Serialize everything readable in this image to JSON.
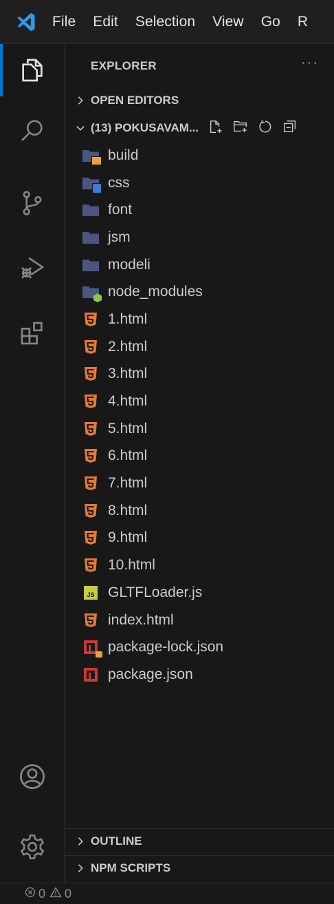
{
  "menubar": {
    "items": [
      "File",
      "Edit",
      "Selection",
      "View",
      "Go",
      "R"
    ]
  },
  "activity_bar": {
    "items": [
      "explorer-icon",
      "search-icon",
      "source-control-icon",
      "run-debug-icon",
      "extensions-icon"
    ],
    "bottom": [
      "accounts-icon",
      "manage-gear-icon"
    ],
    "accent_color": "#0078d4"
  },
  "explorer": {
    "title": "EXPLORER",
    "more": "···",
    "open_editors": "OPEN EDITORS",
    "folder": "(13) POKUSAVAM...",
    "items": [
      {
        "name": "build",
        "type": "folder",
        "badge": "package"
      },
      {
        "name": "css",
        "type": "folder",
        "badge": "css"
      },
      {
        "name": "font",
        "type": "folder",
        "badge": ""
      },
      {
        "name": "jsm",
        "type": "folder",
        "badge": ""
      },
      {
        "name": "modeli",
        "type": "folder",
        "badge": ""
      },
      {
        "name": "node_modules",
        "type": "folder",
        "badge": "node"
      },
      {
        "name": "1.html",
        "type": "html"
      },
      {
        "name": "2.html",
        "type": "html"
      },
      {
        "name": "3.html",
        "type": "html"
      },
      {
        "name": "4.html",
        "type": "html"
      },
      {
        "name": "5.html",
        "type": "html"
      },
      {
        "name": "6.html",
        "type": "html"
      },
      {
        "name": "7.html",
        "type": "html"
      },
      {
        "name": "8.html",
        "type": "html"
      },
      {
        "name": "9.html",
        "type": "html"
      },
      {
        "name": "10.html",
        "type": "html"
      },
      {
        "name": "GLTFLoader.js",
        "type": "js"
      },
      {
        "name": "index.html",
        "type": "html"
      },
      {
        "name": "package-lock.json",
        "type": "npm-lock"
      },
      {
        "name": "package.json",
        "type": "npm"
      }
    ],
    "outline": "OUTLINE",
    "npm_scripts": "NPM SCRIPTS"
  },
  "status_bar": {
    "errors": "0",
    "warnings": "0"
  }
}
